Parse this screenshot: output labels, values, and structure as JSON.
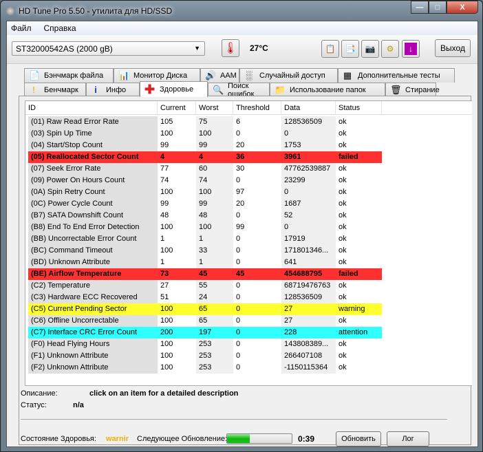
{
  "window": {
    "title": "HD Tune Pro 5.50 - утилита для HD/SSD",
    "min": "—",
    "max": "□",
    "close": "X"
  },
  "menu": [
    {
      "label": "Файл"
    },
    {
      "label": "Справка"
    }
  ],
  "toolbar": {
    "drive": "ST32000542AS (2000 gB)",
    "temperature": "27°C",
    "exit": "Выход"
  },
  "tabs_row1": [
    {
      "label": "Бэнчмарк файла",
      "icon": "file-benchmark-icon"
    },
    {
      "label": "Монитор Диска",
      "icon": "disk-monitor-icon"
    },
    {
      "label": "AAM",
      "icon": "speaker-icon"
    },
    {
      "label": "Случайный доступ",
      "icon": "random-access-icon"
    },
    {
      "label": "Дополнительные  тесты",
      "icon": "extra-tests-icon"
    }
  ],
  "tabs_row2": [
    {
      "label": "Бенчмарк",
      "icon": "benchmark-icon"
    },
    {
      "label": "Инфо",
      "icon": "info-icon"
    },
    {
      "label": "Здоровье",
      "icon": "health-cross-icon"
    },
    {
      "label": "Поиск ошибок",
      "icon": "error-scan-icon"
    },
    {
      "label": "Использование папок",
      "icon": "folder-usage-icon"
    },
    {
      "label": "Стирание",
      "icon": "trash-icon"
    }
  ],
  "table": {
    "columns": [
      "ID",
      "Current",
      "Worst",
      "Threshold",
      "Data",
      "Status"
    ],
    "rows": [
      [
        "(01) Raw Read Error Rate",
        "105",
        "75",
        "6",
        "128536509",
        "ok",
        ""
      ],
      [
        "(03) Spin Up Time",
        "100",
        "100",
        "0",
        "0",
        "ok",
        ""
      ],
      [
        "(04) Start/Stop Count",
        "99",
        "99",
        "20",
        "1753",
        "ok",
        ""
      ],
      [
        "(05) Reallocated Sector Count",
        "4",
        "4",
        "36",
        "3961",
        "failed",
        "failed"
      ],
      [
        "(07) Seek Error Rate",
        "77",
        "60",
        "30",
        "47762539887",
        "ok",
        ""
      ],
      [
        "(09) Power On Hours Count",
        "74",
        "74",
        "0",
        "23299",
        "ok",
        ""
      ],
      [
        "(0A) Spin Retry Count",
        "100",
        "100",
        "97",
        "0",
        "ok",
        ""
      ],
      [
        "(0C) Power Cycle Count",
        "99",
        "99",
        "20",
        "1687",
        "ok",
        ""
      ],
      [
        "(B7) SATA Downshift Count",
        "48",
        "48",
        "0",
        "52",
        "ok",
        ""
      ],
      [
        "(B8) End To End Error Detection",
        "100",
        "100",
        "99",
        "0",
        "ok",
        ""
      ],
      [
        "(BB) Uncorrectable Error Count",
        "1",
        "1",
        "0",
        "17919",
        "ok",
        ""
      ],
      [
        "(BC) Command Timeout",
        "100",
        "33",
        "0",
        "171801346...",
        "ok",
        ""
      ],
      [
        "(BD) Unknown Attribute",
        "1",
        "1",
        "0",
        "641",
        "ok",
        ""
      ],
      [
        "(BE) Airflow Temperature",
        "73",
        "45",
        "45",
        "454688795",
        "failed",
        "failed"
      ],
      [
        "(C2) Temperature",
        "27",
        "55",
        "0",
        "68719476763",
        "ok",
        ""
      ],
      [
        "(C3) Hardware ECC Recovered",
        "51",
        "24",
        "0",
        "128536509",
        "ok",
        ""
      ],
      [
        "(C5) Current Pending Sector",
        "100",
        "65",
        "0",
        "27",
        "warning",
        "warning"
      ],
      [
        "(C6) Offline Uncorrectable",
        "100",
        "65",
        "0",
        "27",
        "ok",
        ""
      ],
      [
        "(C7) Interface CRC Error Count",
        "200",
        "197",
        "0",
        "228",
        "attention",
        "attention"
      ],
      [
        "(F0) Head Flying Hours",
        "100",
        "253",
        "0",
        "143808389...",
        "ok",
        ""
      ],
      [
        "(F1) Unknown Attribute",
        "100",
        "253",
        "0",
        "266407108",
        "ok",
        ""
      ],
      [
        "(F2) Unknown Attribute",
        "100",
        "253",
        "0",
        "-1150115364",
        "ok",
        ""
      ]
    ]
  },
  "details": {
    "desc_label": "Описание:",
    "desc_value": "click on an item for a detailed description",
    "status_label": "Статус:",
    "status_value": "n/a"
  },
  "footer": {
    "health_label": "Состояние Здоровья:",
    "health_value": "warnir",
    "health_color": "#f0b000",
    "next_label": "Следующее Обновление:",
    "progress_percent": 35,
    "countdown": "0:39",
    "refresh": "Обновить",
    "log": "Лог"
  }
}
